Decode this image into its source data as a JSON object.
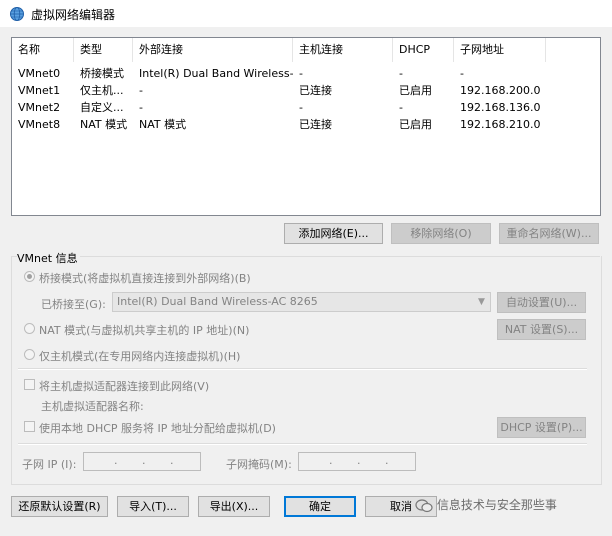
{
  "window": {
    "title": "虚拟网络编辑器",
    "icon": "globe-network-icon"
  },
  "table": {
    "headers": [
      "名称",
      "类型",
      "外部连接",
      "主机连接",
      "DHCP",
      "子网地址"
    ],
    "rows": [
      [
        "VMnet0",
        "桥接模式",
        "Intel(R) Dual Band Wireless-...",
        "-",
        "-",
        "-"
      ],
      [
        "VMnet1",
        "仅主机...",
        "-",
        "已连接",
        "已启用",
        "192.168.200.0"
      ],
      [
        "VMnet2",
        "自定义...",
        "-",
        "-",
        "-",
        "192.168.136.0"
      ],
      [
        "VMnet8",
        "NAT 模式",
        "NAT 模式",
        "已连接",
        "已启用",
        "192.168.210.0"
      ]
    ]
  },
  "list_buttons": {
    "add": "添加网络(E)...",
    "remove": "移除网络(O)",
    "rename": "重命名网络(W)..."
  },
  "info": {
    "group_title": "VMnet 信息",
    "bridged_mode": "桥接模式(将虚拟机直接连接到外部网络)(B)",
    "bridged_to_label": "已桥接至(G):",
    "bridged_to_value": "Intel(R) Dual Band Wireless-AC 8265",
    "auto_settings": "自动设置(U)...",
    "nat_mode": "NAT 模式(与虚拟机共享主机的 IP 地址)(N)",
    "nat_settings": "NAT 设置(S)...",
    "host_only_mode": "仅主机模式(在专用网络内连接虚拟机)(H)",
    "connect_adapter": "将主机虚拟适配器连接到此网络(V)",
    "adapter_name_label": "主机虚拟适配器名称:",
    "use_dhcp": "使用本地 DHCP 服务将 IP 地址分配给虚拟机(D)",
    "dhcp_settings": "DHCP 设置(P)...",
    "subnet_ip_label": "子网 IP (I):",
    "subnet_mask_label": "子网掩码(M):",
    "ip_dot": "."
  },
  "footer": {
    "restore_defaults": "还原默认设置(R)",
    "import": "导入(T)...",
    "export": "导出(X)...",
    "ok": "确定",
    "cancel": "取消",
    "watermark": "信息技术与安全那些事"
  }
}
